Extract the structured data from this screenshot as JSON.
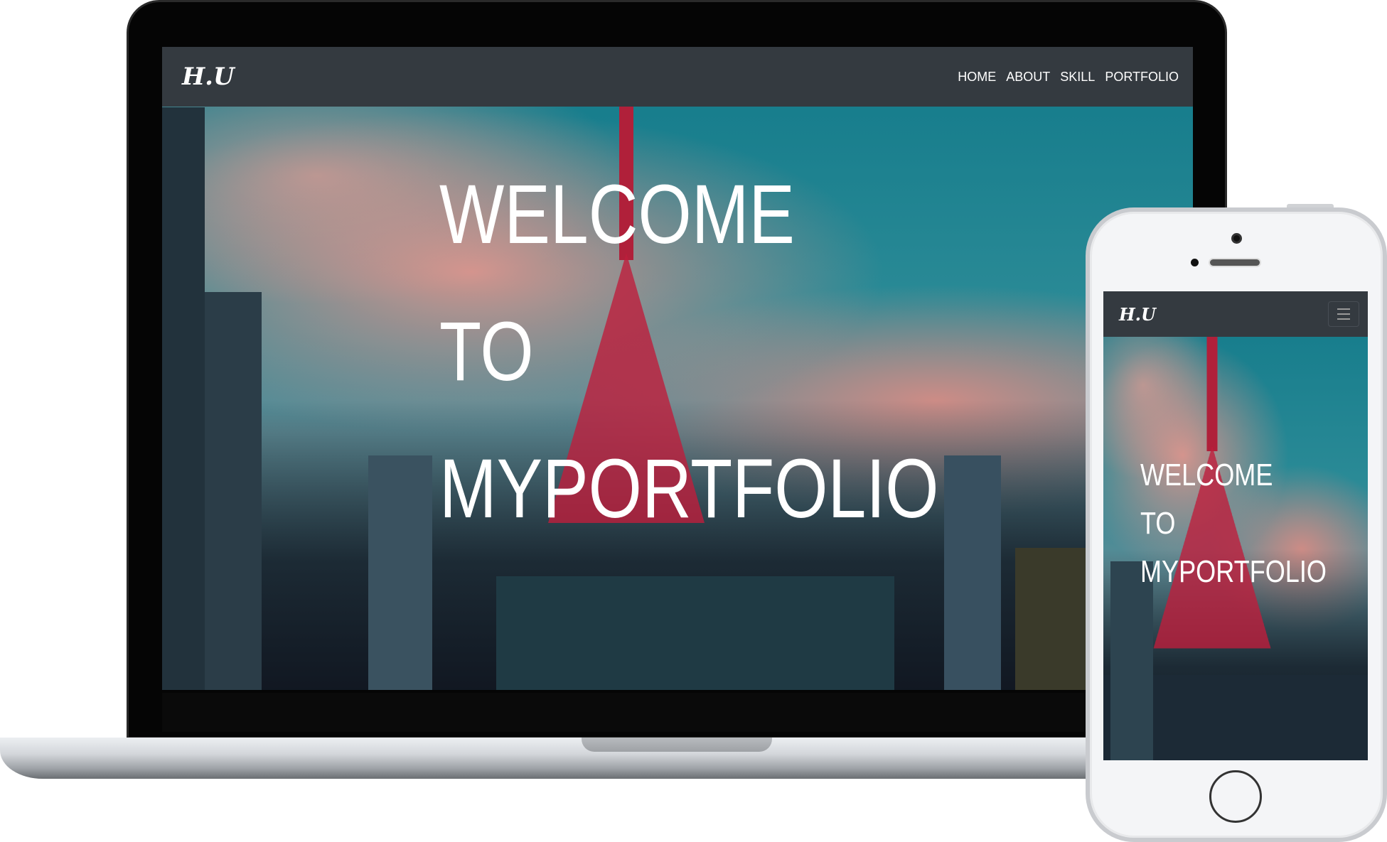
{
  "desktop": {
    "brand": "H.U",
    "nav": [
      "HOME",
      "ABOUT",
      "SKILL",
      "PORTFOLIO"
    ],
    "hero": [
      "WELCOME",
      "TO",
      "MYPORTFOLIO"
    ]
  },
  "mobile": {
    "brand": "H.U",
    "menu_icon": "hamburger-icon",
    "hero": [
      "WELCOME",
      "TO",
      "MYPORTFOLIO"
    ]
  },
  "colors": {
    "navbar": "#343a40",
    "text": "#ffffff"
  }
}
